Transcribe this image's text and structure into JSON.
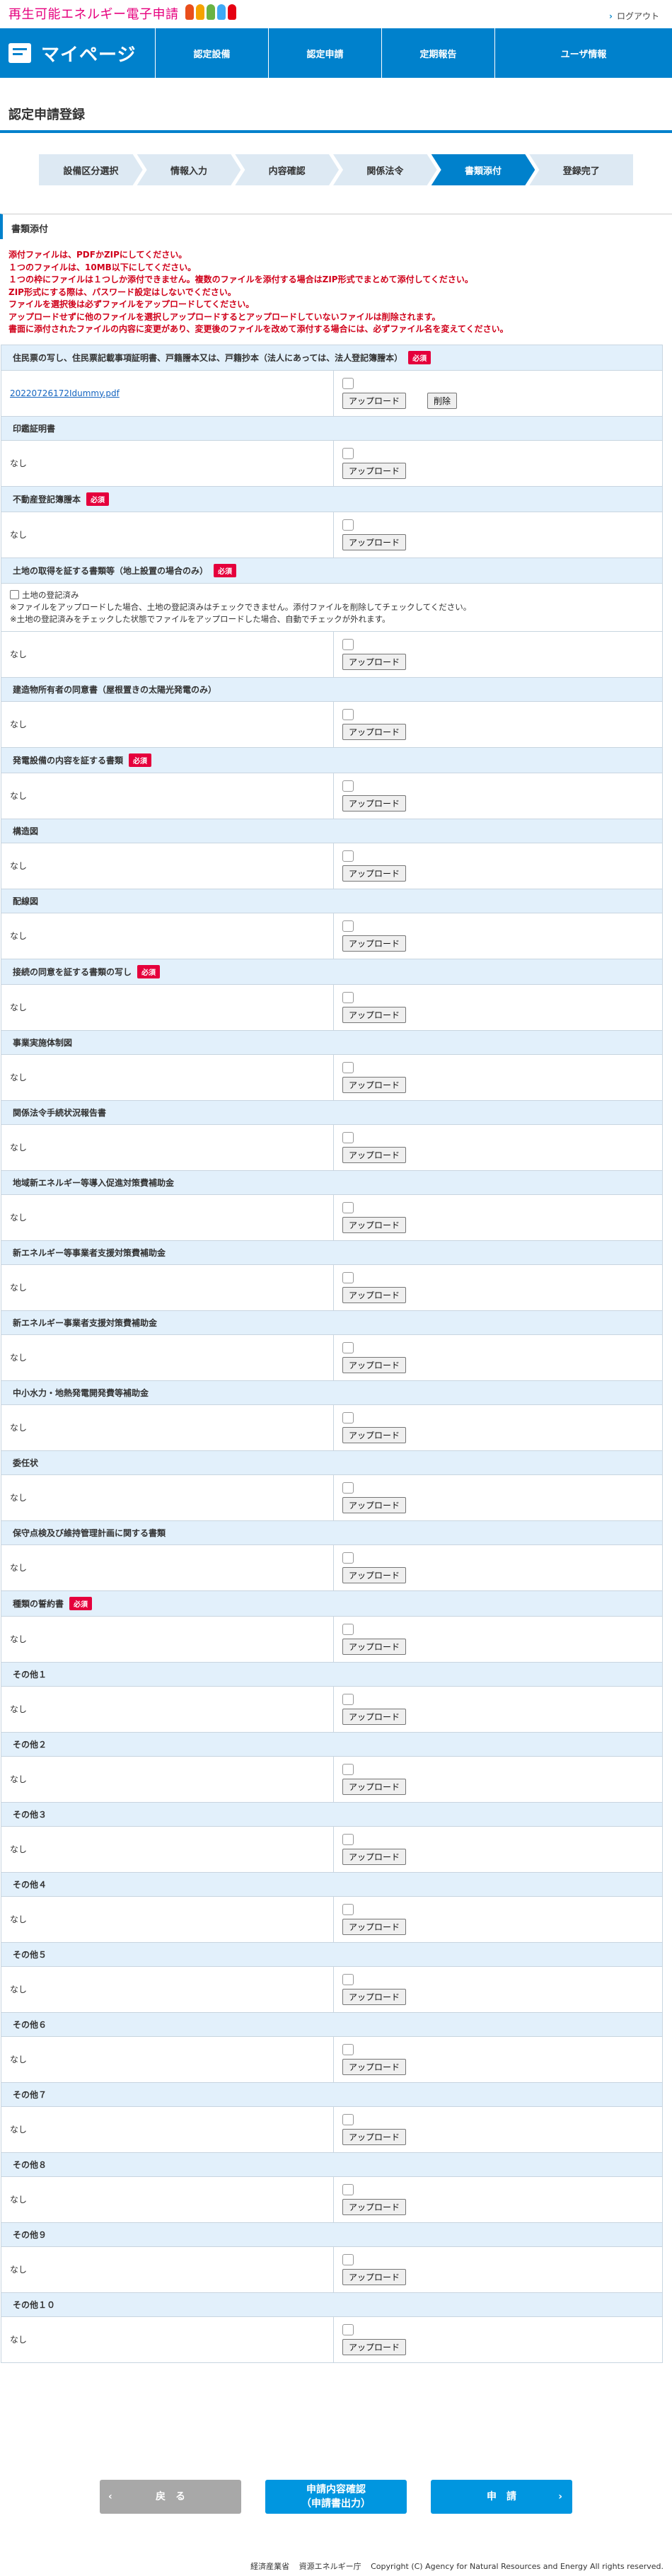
{
  "header": {
    "site_title": "再生可能エネルギー電子申請",
    "logout": "ログアウト",
    "mascot_colors": [
      "#e94e1b",
      "#f5a200",
      "#6ab344",
      "#3fa9f5",
      "#e60012"
    ]
  },
  "nav": {
    "home": "マイページ",
    "items": [
      "認定設備",
      "認定申請",
      "定期報告",
      "ユーザ情報"
    ]
  },
  "page_title": "認定申請登録",
  "steps": [
    {
      "label": "設備区分選択",
      "active": false
    },
    {
      "label": "情報入力",
      "active": false
    },
    {
      "label": "内容確認",
      "active": false
    },
    {
      "label": "関係法令",
      "active": false
    },
    {
      "label": "書類添付",
      "active": true
    },
    {
      "label": "登録完了",
      "active": false
    }
  ],
  "section_title": "書類添付",
  "notes": [
    "添付ファイルは、PDFかZIPにしてください。",
    "１つのファイルは、10MB以下にしてください。",
    "１つの枠にファイルは１つしか添付できません。複数のファイルを添付する場合はZIP形式でまとめて添付してください。",
    "ZIP形式にする際は、パスワード設定はしないでください。",
    "ファイルを選択後は必ずファイルをアップロードしてください。",
    "アップロードせずに他のファイルを選択しアップロードするとアップロードしていないファイルは削除されます。",
    "書面に添付されたファイルの内容に変更があり、変更後のファイルを改めて添付する場合には、必ずファイル名を変えてください。"
  ],
  "labels": {
    "required": "必須",
    "upload": "アップロード",
    "delete": "削除",
    "none": "なし"
  },
  "documents": [
    {
      "title": "住民票の写し、住民票記載事項証明書、戸籍謄本又は、戸籍抄本（法人にあっては、法人登記簿謄本）",
      "required": true,
      "file": "20220726172Idummy.pdf",
      "has_delete": true
    },
    {
      "title": "印鑑証明書",
      "required": false
    },
    {
      "title": "不動産登記簿謄本",
      "required": true
    },
    {
      "title": "土地の取得を証する書類等（地上設置の場合のみ）",
      "required": true,
      "extra": {
        "checkbox": "土地の登記済み",
        "notes": [
          "※ファイルをアップロードした場合、土地の登記済みはチェックできません。添付ファイルを削除してチェックしてください。",
          "※土地の登記済みをチェックした状態でファイルをアップロードした場合、自動でチェックが外れます。"
        ]
      }
    },
    {
      "title": "建造物所有者の同意書（屋根置きの太陽光発電のみ）",
      "required": false
    },
    {
      "title": "発電設備の内容を証する書類",
      "required": true
    },
    {
      "title": "構造図",
      "required": false
    },
    {
      "title": "配線図",
      "required": false
    },
    {
      "title": "接続の同意を証する書類の写し",
      "required": true
    },
    {
      "title": "事業実施体制図",
      "required": false
    },
    {
      "title": "関係法令手続状況報告書",
      "required": false
    },
    {
      "title": "地域新エネルギー等導入促進対策費補助金",
      "required": false
    },
    {
      "title": "新エネルギー等事業者支援対策費補助金",
      "required": false
    },
    {
      "title": "新エネルギー事業者支援対策費補助金",
      "required": false
    },
    {
      "title": "中小水力・地熱発電開発費等補助金",
      "required": false
    },
    {
      "title": "委任状",
      "required": false
    },
    {
      "title": "保守点検及び維持管理計画に関する書類",
      "required": false
    },
    {
      "title": "種類の誓約書",
      "required": true
    },
    {
      "title": "その他１",
      "required": false
    },
    {
      "title": "その他２",
      "required": false
    },
    {
      "title": "その他３",
      "required": false
    },
    {
      "title": "その他４",
      "required": false
    },
    {
      "title": "その他５",
      "required": false
    },
    {
      "title": "その他６",
      "required": false
    },
    {
      "title": "その他７",
      "required": false
    },
    {
      "title": "その他８",
      "required": false
    },
    {
      "title": "その他９",
      "required": false
    },
    {
      "title": "その他１０",
      "required": false
    }
  ],
  "buttons": {
    "back": "戻　る",
    "confirm_line1": "申請内容確認",
    "confirm_line2": "（申請書出力）",
    "apply": "申　請"
  },
  "footer": {
    "ministry": "経済産業省",
    "agency": "資源エネルギー庁",
    "copyright": "Copyright (C) Agency for Natural Resources and Energy All rights reserved."
  }
}
